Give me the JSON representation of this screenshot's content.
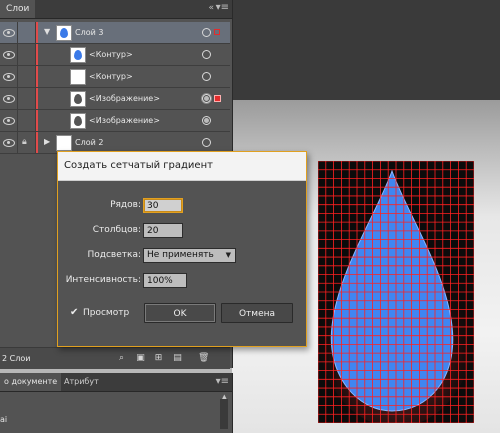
{
  "layers_panel": {
    "tab_label": "Слои",
    "close_glyph": "«",
    "menu_glyph": "▾≡",
    "rows": [
      {
        "name": "Слой 3",
        "expanded": true
      },
      {
        "name": "<Контур>"
      },
      {
        "name": "<Контур>"
      },
      {
        "name": "<Изображение>"
      },
      {
        "name": "<Изображение>"
      },
      {
        "name": "Слой 2",
        "expanded": false
      }
    ],
    "layer_count": "2 Слои",
    "accent_color": "#e14b4b"
  },
  "doc_panel": {
    "tab_document": "о документе",
    "tab_attributes": "Атрибут",
    "menu_glyph": "▾≡",
    "file_label": "ai"
  },
  "dialog": {
    "title": "Создать сетчатый градиент",
    "rows_label": "Рядов:",
    "rows_value": "30",
    "columns_label": "Столбцов:",
    "columns_value": "20",
    "backlight_label": "Подсветка:",
    "backlight_value": "Не применять",
    "intensity_label": "Интенсивность:",
    "intensity_value": "100%",
    "preview_label": "Просмотр",
    "preview_checked": true,
    "ok_label": "OK",
    "cancel_label": "Отмена",
    "focus_color": "#e2a020"
  },
  "canvas": {
    "mesh_rows": 30,
    "mesh_columns": 20,
    "mesh_line_color": "#ff2020",
    "drop_fill": "#3f86f2"
  }
}
